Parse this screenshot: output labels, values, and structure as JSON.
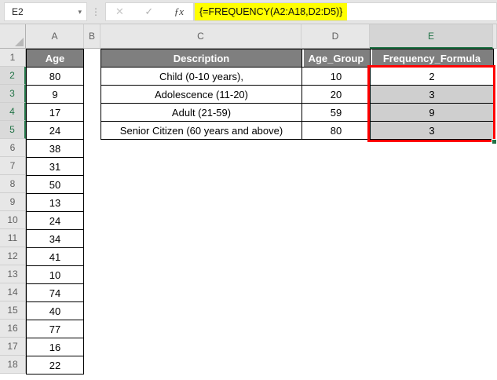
{
  "toolbar": {
    "name_box_value": "E2",
    "dropdown_icon": "▾",
    "separator_dots_icon": "⋮",
    "cancel_icon": "✕",
    "enter_icon": "✓",
    "fx_icon": "ƒx",
    "formula_text": "{=FREQUENCY(A2:A18,D2:D5)}"
  },
  "grid": {
    "column_letters": [
      "A",
      "B",
      "C",
      "D",
      "E"
    ],
    "selected_column": "E",
    "row_numbers": [
      "1",
      "2",
      "3",
      "4",
      "5",
      "6",
      "7",
      "8",
      "9",
      "10",
      "11",
      "12",
      "13",
      "14",
      "15",
      "16",
      "17",
      "18"
    ],
    "selected_rows": [
      "2",
      "3",
      "4",
      "5"
    ],
    "active_cell": "E2"
  },
  "age_table": {
    "header": "Age",
    "values": [
      "80",
      "9",
      "17",
      "24",
      "38",
      "31",
      "50",
      "13",
      "24",
      "34",
      "41",
      "10",
      "74",
      "40",
      "77",
      "16",
      "22"
    ]
  },
  "frequency_table": {
    "description_header": "Description",
    "age_group_header": "Age_Group",
    "frequency_header": "Frequency_Formula",
    "rows": [
      {
        "description": "Child (0-10 years),",
        "age_group": "10",
        "frequency": "2"
      },
      {
        "description": "Adolescence (11-20)",
        "age_group": "20",
        "frequency": "3"
      },
      {
        "description": "Adult (21-59)",
        "age_group": "59",
        "frequency": "9"
      },
      {
        "description": "Senior Citizen (60 years and above)",
        "age_group": "80",
        "frequency": "3"
      }
    ]
  },
  "colors": {
    "table_header_fill": "#7f7f7f",
    "table_header_text": "#ffffff",
    "selected_cell_fill": "#cfcfcf",
    "selection_outline": "#ff0000",
    "excel_green": "#217346",
    "formula_highlight": "#ffff00"
  }
}
